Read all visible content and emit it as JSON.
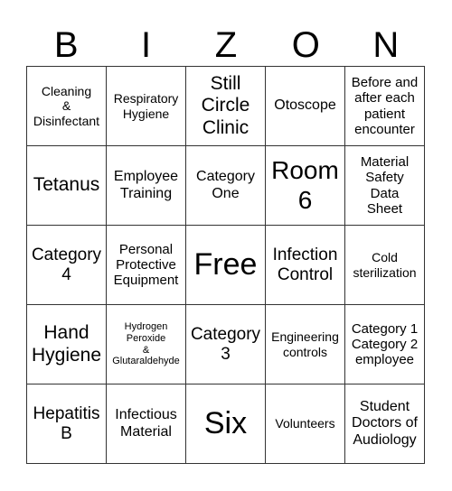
{
  "header": {
    "letters": [
      "B",
      "I",
      "Z",
      "O",
      "N"
    ]
  },
  "grid": {
    "rows": [
      [
        "Cleaning\n&\nDisinfectant",
        "Respiratory\nHygiene",
        "Still\nCircle\nClinic",
        "Otoscope",
        "Before and\nafter each\npatient\nencounter"
      ],
      [
        "Tetanus",
        "Employee\nTraining",
        "Category\nOne",
        "Room\n6",
        "Material\nSafety\nData\nSheet"
      ],
      [
        "Category\n4",
        "Personal\nProtective\nEquipment",
        "Free",
        "Infection\nControl",
        "Cold\nsterilization"
      ],
      [
        "Hand\nHygiene",
        "Hydrogen\nPeroxide\n&\nGlutaraldehyde",
        "Category\n3",
        "Engineering\ncontrols",
        "Category 1\nCategory 2\nemployee"
      ],
      [
        "Hepatitis\nB",
        "Infectious\nMaterial",
        "Six",
        "Volunteers",
        "Student\nDoctors of\nAudiology"
      ]
    ]
  }
}
